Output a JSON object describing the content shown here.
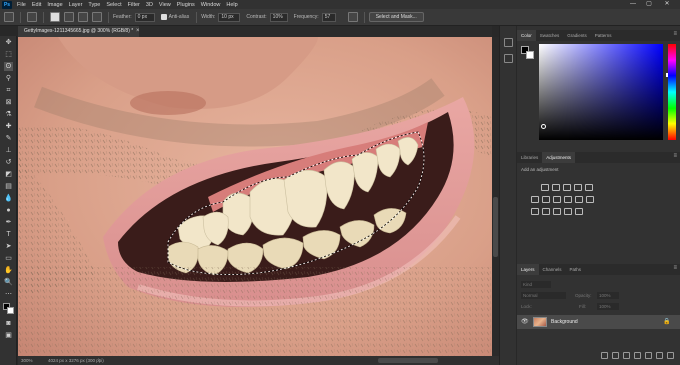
{
  "menu": [
    "File",
    "Edit",
    "Image",
    "Layer",
    "Type",
    "Select",
    "Filter",
    "3D",
    "View",
    "Plugins",
    "Window",
    "Help"
  ],
  "app_logo": "Ps",
  "window_controls": [
    "—",
    "▢",
    "✕"
  ],
  "options": {
    "feather_label": "Feather:",
    "feather_value": "0 px",
    "antialias_label": "Anti-alias",
    "width_label": "Width:",
    "width_value": "10 px",
    "contrast_label": "Contrast:",
    "contrast_value": "10%",
    "frequency_label": "Frequency:",
    "frequency_value": "57",
    "select_mask_button": "Select and Mask..."
  },
  "document": {
    "tab_title": "GettyImages-1211345665.jpg @ 300% (RGB/8) *",
    "zoom": "300%",
    "doc_size": "4024 px x 3276 px (300 ppi)"
  },
  "panels": {
    "top_tabs": [
      "Color",
      "Swatches",
      "Gradients",
      "Patterns"
    ],
    "mid_tabs": [
      "Libraries",
      "Adjustments"
    ],
    "adjustments_hint": "Add an adjustment",
    "layer_tabs": [
      "Layers",
      "Channels",
      "Paths"
    ],
    "layer_kind": "Kind",
    "layer_blend": "Normal",
    "layer_opacity_label": "Opacity:",
    "layer_opacity_value": "100%",
    "layer_fill_label": "Fill:",
    "layer_fill_value": "100%",
    "layer_lock_label": "Lock:",
    "layer_name": "Background"
  },
  "colors": {
    "foreground": "#000000",
    "background": "#ffffff",
    "hue_marker": "#0000ff"
  }
}
